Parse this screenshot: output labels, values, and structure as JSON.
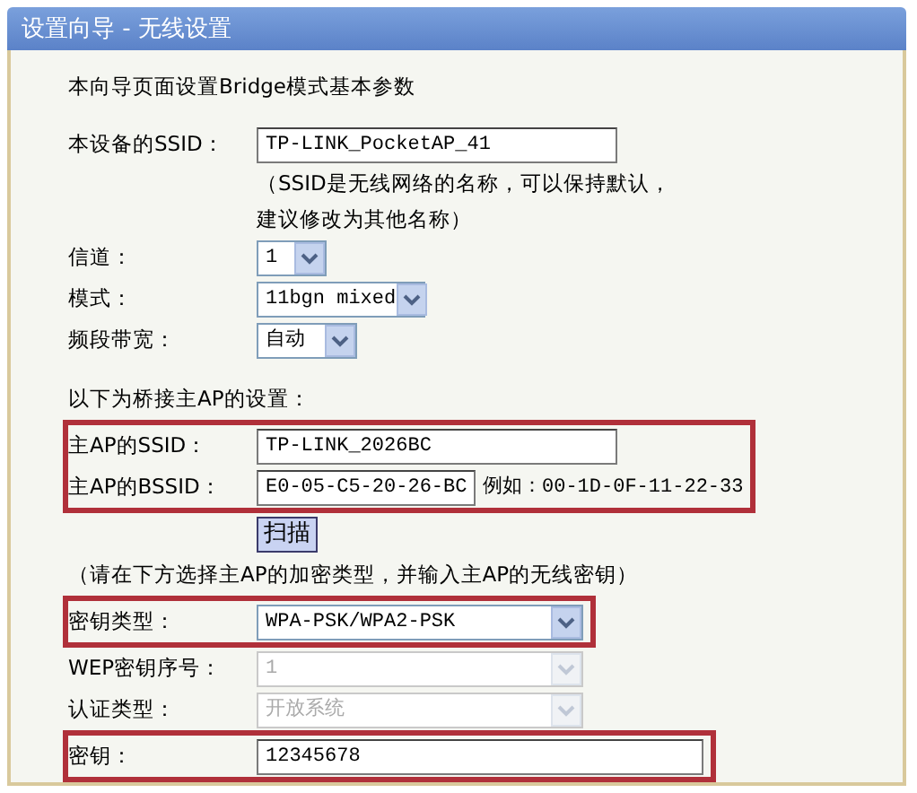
{
  "window": {
    "title": "设置向导 - 无线设置"
  },
  "intro": "本向导页面设置Bridge模式基本参数",
  "sections": [
    {
      "highlighted": false,
      "rows": [
        {
          "kind": "input",
          "label": "本设备的SSID：",
          "value": "TP-LINK_PocketAP_41"
        },
        {
          "kind": "hint",
          "lines": [
            "（SSID是无线网络的名称，可以保持默认，",
            "建议修改为其他名称）"
          ]
        },
        {
          "kind": "select",
          "label": "信道：",
          "value": "1",
          "disabled": false
        },
        {
          "kind": "select",
          "label": "模式：",
          "value": "11bgn mixed",
          "disabled": false
        },
        {
          "kind": "select",
          "label": "频段带宽：",
          "value": "自动",
          "disabled": false
        },
        {
          "kind": "heading",
          "text": "以下为桥接主AP的设置："
        }
      ]
    },
    {
      "highlighted": true,
      "rows": [
        {
          "kind": "input",
          "label": "主AP的SSID：",
          "value": "TP-LINK_2026BC"
        },
        {
          "kind": "input",
          "label": "主AP的BSSID：",
          "value": "E0-05-C5-20-26-BC",
          "example": "例如：00-1D-0F-11-22-33"
        }
      ]
    },
    {
      "highlighted": false,
      "rows": [
        {
          "kind": "button",
          "label": "扫描"
        },
        {
          "kind": "note",
          "text": "（请在下方选择主AP的加密类型，并输入主AP的无线密钥）"
        }
      ]
    },
    {
      "highlighted": true,
      "rows": [
        {
          "kind": "select",
          "label": "密钥类型：",
          "value": "WPA-PSK/WPA2-PSK",
          "disabled": false
        }
      ]
    },
    {
      "highlighted": false,
      "rows": [
        {
          "kind": "select",
          "label": "WEP密钥序号：",
          "value": "1",
          "disabled": true
        },
        {
          "kind": "select",
          "label": "认证类型：",
          "value": "开放系统",
          "disabled": true
        }
      ]
    },
    {
      "highlighted": true,
      "rows": [
        {
          "kind": "input",
          "label": "密钥：",
          "value": "12345678"
        }
      ]
    }
  ]
}
